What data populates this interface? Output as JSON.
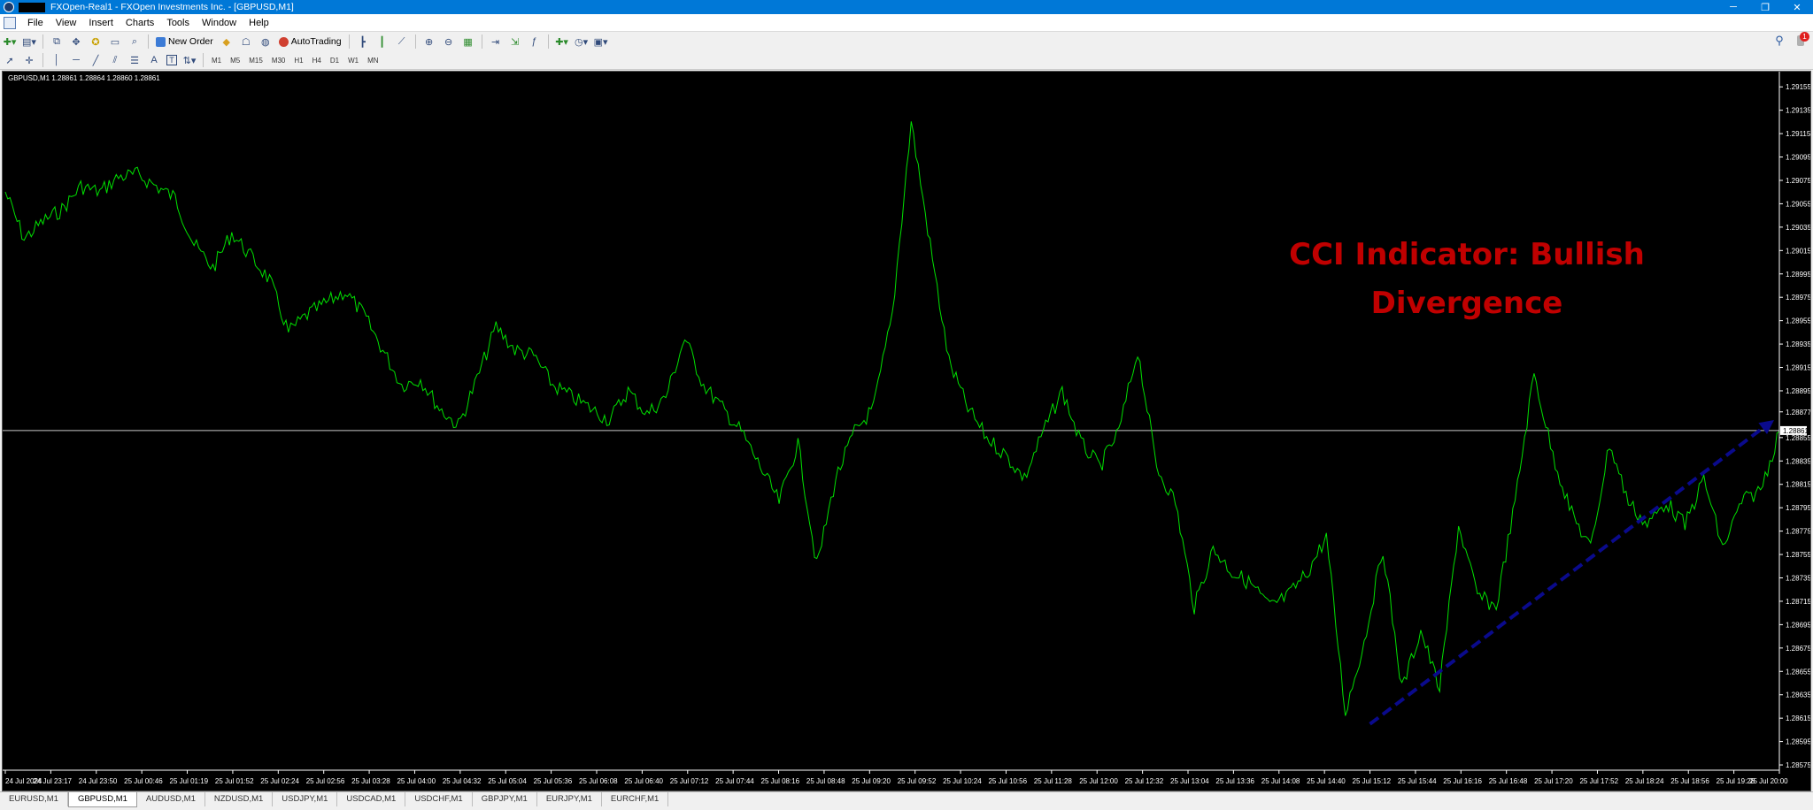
{
  "window": {
    "title": "FXOpen-Real1 - FXOpen Investments Inc. - [GBPUSD,M1]",
    "controls": [
      "─",
      "❐",
      "✕"
    ]
  },
  "menu": [
    "File",
    "View",
    "Insert",
    "Charts",
    "Tools",
    "Window",
    "Help"
  ],
  "toolbar": {
    "new_order": "New Order",
    "autotrading": "AutoTrading",
    "timeframes": [
      "M1",
      "M5",
      "M15",
      "M30",
      "H1",
      "H4",
      "D1",
      "W1",
      "MN"
    ],
    "notification_count": "1",
    "text_tool": "A",
    "label_tool": "T"
  },
  "chart": {
    "info": "GBPUSD,M1  1.28861 1.28864 1.28860 1.28861",
    "annotation_line1": "CCI Indicator: Bullish",
    "annotation_line2": "Divergence",
    "current_price_label": "1.28861",
    "colors": {
      "price_line": "#00e000",
      "arrow": "#0a0a8c",
      "annotation": "#c00000",
      "bid_line": "#c8c8c8"
    }
  },
  "chart_data": {
    "type": "line",
    "symbol": "GBPUSD",
    "timeframe": "M1",
    "current_price": 1.28861,
    "y_ticks": [
      "1.29155",
      "1.29135",
      "1.29115",
      "1.29095",
      "1.29075",
      "1.29055",
      "1.29035",
      "1.29015",
      "1.28995",
      "1.28975",
      "1.28955",
      "1.28935",
      "1.28915",
      "1.28895",
      "1.28877",
      "1.28855",
      "1.28835",
      "1.28815",
      "1.28795",
      "1.28775",
      "1.28755",
      "1.28735",
      "1.28715",
      "1.28695",
      "1.28675",
      "1.28655",
      "1.28635",
      "1.28615",
      "1.28595",
      "1.28575"
    ],
    "ylim": [
      1.28572,
      1.29165
    ],
    "x_ticks": [
      "24 Jul 2024",
      "24 Jul 23:17",
      "24 Jul 23:50",
      "25 Jul 00:46",
      "25 Jul 01:19",
      "25 Jul 01:52",
      "25 Jul 02:24",
      "25 Jul 02:56",
      "25 Jul 03:28",
      "25 Jul 04:00",
      "25 Jul 04:32",
      "25 Jul 05:04",
      "25 Jul 05:36",
      "25 Jul 06:08",
      "25 Jul 06:40",
      "25 Jul 07:12",
      "25 Jul 07:44",
      "25 Jul 08:16",
      "25 Jul 08:48",
      "25 Jul 09:20",
      "25 Jul 09:52",
      "25 Jul 10:24",
      "25 Jul 10:56",
      "25 Jul 11:28",
      "25 Jul 12:00",
      "25 Jul 12:32",
      "25 Jul 13:04",
      "25 Jul 13:36",
      "25 Jul 14:08",
      "25 Jul 14:40",
      "25 Jul 15:12",
      "25 Jul 15:44",
      "25 Jul 16:16",
      "25 Jul 16:48",
      "25 Jul 17:20",
      "25 Jul 17:52",
      "25 Jul 18:24",
      "25 Jul 18:56",
      "25 Jul 19:28",
      "25 Jul 20:00"
    ],
    "series": [
      {
        "values": [
          1.29065,
          1.29025,
          1.2904,
          1.2905,
          1.2907,
          1.29065,
          1.29078,
          1.2908,
          1.2907,
          1.2906,
          1.2902,
          1.29,
          1.2903,
          1.2901,
          1.2899,
          1.28945,
          1.2896,
          1.2897,
          1.2898,
          1.2896,
          1.2893,
          1.289,
          1.28905,
          1.2888,
          1.28865,
          1.28905,
          1.2895,
          1.2893,
          1.28925,
          1.289,
          1.2889,
          1.2888,
          1.2887,
          1.28895,
          1.28875,
          1.2889,
          1.2894,
          1.289,
          1.2888,
          1.2886,
          1.2883,
          1.288,
          1.2885,
          1.28745,
          1.2882,
          1.2886,
          1.2888,
          1.2896,
          1.29125,
          1.2902,
          1.2892,
          1.2888,
          1.28855,
          1.2884,
          1.2882,
          1.2886,
          1.28895,
          1.2885,
          1.2883,
          1.2886,
          1.2893,
          1.2883,
          1.288,
          1.2871,
          1.2876,
          1.2874,
          1.2873,
          1.2871,
          1.2872,
          1.2874,
          1.2877,
          1.2862,
          1.2868,
          1.2876,
          1.2864,
          1.2869,
          1.2864,
          1.2878,
          1.2872,
          1.2871,
          1.288,
          1.2891,
          1.2884,
          1.2879,
          1.2876,
          1.2885,
          1.288,
          1.2878,
          1.288,
          1.2878,
          1.2882,
          1.2876,
          1.288,
          1.2881,
          1.2886
        ]
      }
    ],
    "trendline": {
      "from": {
        "x": "25 Jul 15:12",
        "y": 1.2861
      },
      "to": {
        "x": "25 Jul 20:00",
        "y": 1.2887
      },
      "style": "dashed-arrow"
    }
  },
  "tabs": [
    "EURUSD,M1",
    "GBPUSD,M1",
    "AUDUSD,M1",
    "NZDUSD,M1",
    "USDJPY,M1",
    "USDCAD,M1",
    "USDCHF,M1",
    "GBPJPY,M1",
    "EURJPY,M1",
    "EURCHF,M1"
  ],
  "active_tab": "GBPUSD,M1"
}
